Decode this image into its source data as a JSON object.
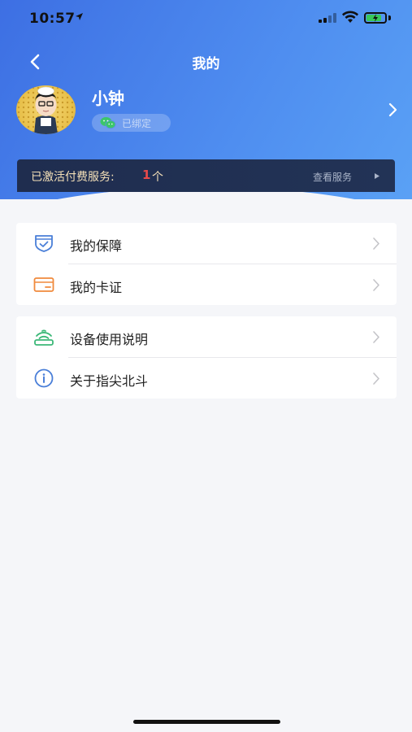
{
  "status_bar": {
    "time": "10:57",
    "battery_level": 0.8,
    "signal_bars": 2
  },
  "nav": {
    "title": "我的",
    "back_icon": "chevron-left-icon"
  },
  "profile": {
    "name": "小钟",
    "bind_status": "已绑定",
    "bind_icon": "wechat-icon"
  },
  "service_banner": {
    "label": "已激活付费服务:",
    "count": "1",
    "unit": "个",
    "link_label": "查看服务"
  },
  "menu_groups": [
    {
      "items": [
        {
          "label": "我的保障",
          "icon": "shield-check-icon",
          "icon_color": "#4a7fd8"
        },
        {
          "label": "我的卡证",
          "icon": "card-icon",
          "icon_color": "#f08a3c"
        }
      ]
    },
    {
      "items": [
        {
          "label": "设备使用说明",
          "icon": "device-signal-icon",
          "icon_color": "#3cb878"
        },
        {
          "label": "关于指尖北斗",
          "icon": "info-icon",
          "icon_color": "#4a7fd8"
        }
      ]
    }
  ],
  "colors": {
    "header_start": "#3d6fe3",
    "header_end": "#5aa1f5",
    "banner_bg": "#1f2d4f",
    "banner_text": "#f4e0b8",
    "count_color": "#e84a4a",
    "page_bg": "#f5f6f9"
  }
}
